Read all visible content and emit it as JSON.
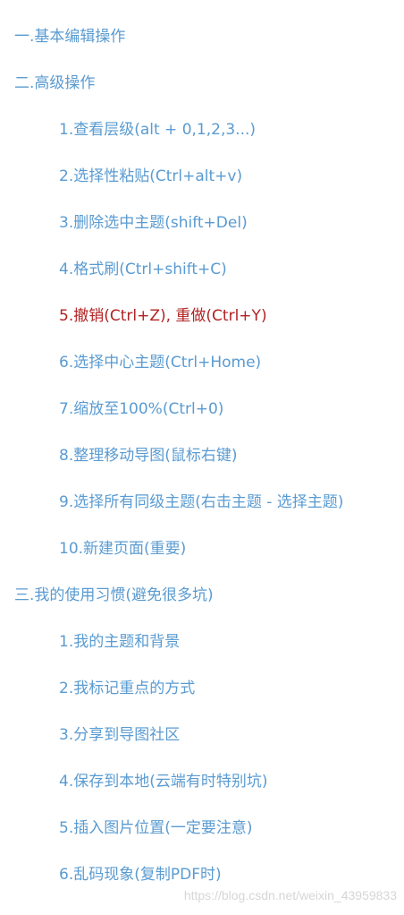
{
  "toc": {
    "sections": [
      {
        "label": "一.基本编辑操作",
        "items": []
      },
      {
        "label": "二.高级操作",
        "items": [
          "1.查看层级(alt + 0,1,2,3...)",
          "2.选择性粘贴(Ctrl+alt+v)",
          "3.删除选中主题(shift+Del)",
          "4.格式刷(Ctrl+shift+C)",
          "5.撤销(Ctrl+Z), 重做(Ctrl+Y)",
          "6.选择中心主题(Ctrl+Home)",
          "7.缩放至100%(Ctrl+0)",
          "8.整理移动导图(鼠标右键)",
          "9.选择所有同级主题(右击主题 - 选择主题)",
          "10.新建页面(重要)"
        ]
      },
      {
        "label": "三.我的使用习惯(避免很多坑)",
        "items": [
          "1.我的主题和背景",
          "2.我标记重点的方式",
          "3.分享到导图社区",
          "4.保存到本地(云端有时特别坑)",
          "5.插入图片位置(一定要注意)",
          "6.乱码现象(复制PDF时)"
        ]
      }
    ]
  },
  "watermark": "https://blog.csdn.net/weixin_43959833",
  "colors": {
    "link": "#5a9bd1",
    "highlight": "#b22222",
    "watermark": "#d6d6d6"
  }
}
